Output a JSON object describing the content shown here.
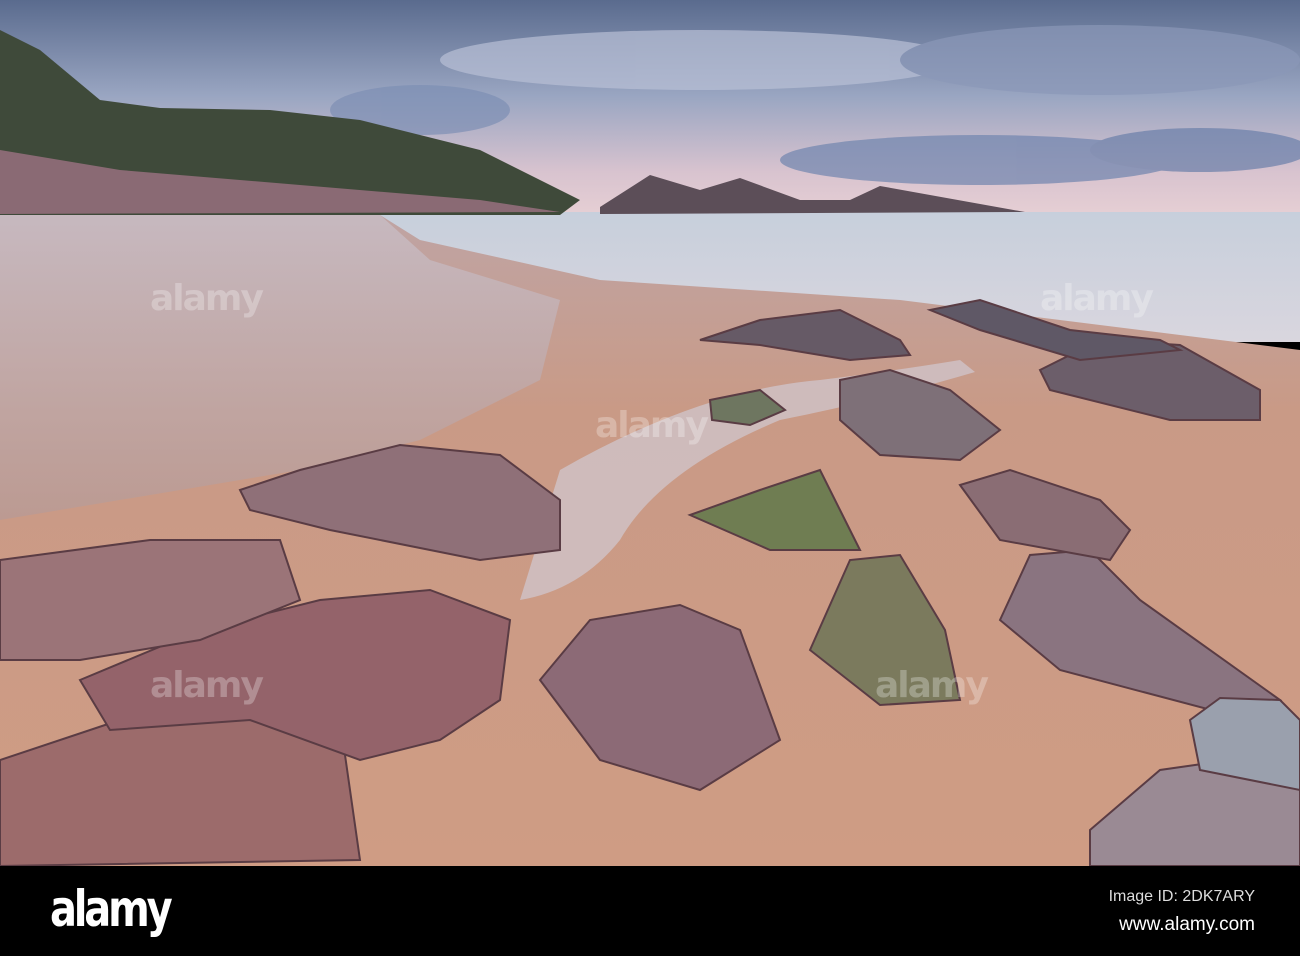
{
  "photo": {
    "subject": "rocky sandy beach at dusk with headland and islets"
  },
  "watermark": {
    "text": "alamy"
  },
  "footer": {
    "logo": "alamy",
    "image_id": "Image ID: 2DK7ARY",
    "website": "www.alamy.com"
  },
  "colors": {
    "sand": "#c99a86",
    "sky": "#8a9ab8",
    "rock": "#8a5d62",
    "footer": "#000000"
  }
}
